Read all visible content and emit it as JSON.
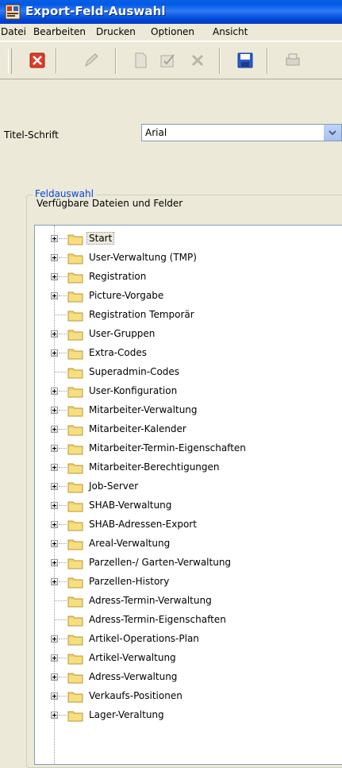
{
  "window": {
    "title": "Export-Feld-Auswahl",
    "app_icon": "app-icon"
  },
  "menu": [
    "Datei",
    "Bearbeiten",
    "Drucken",
    "Optionen",
    "Ansicht"
  ],
  "toolbar": {
    "buttons": [
      "close-red-x-icon",
      "edit-pencil-icon",
      "new-document-icon",
      "check-document-icon",
      "delete-x-icon",
      "save-disk-icon",
      "print-icon"
    ]
  },
  "title_font": {
    "label": "Titel-Schrift",
    "value": "Arial"
  },
  "field_selection": {
    "group_title": "Feldauswahl",
    "list_label": "Verfügbare Dateien und Felder",
    "items": [
      {
        "label": "Start",
        "expandable": true,
        "selected": true
      },
      {
        "label": "User-Verwaltung (TMP)",
        "expandable": true
      },
      {
        "label": "Registration",
        "expandable": true
      },
      {
        "label": "Picture-Vorgabe",
        "expandable": true
      },
      {
        "label": "Registration Temporär",
        "expandable": false
      },
      {
        "label": "User-Gruppen",
        "expandable": true
      },
      {
        "label": "Extra-Codes",
        "expandable": true
      },
      {
        "label": "Superadmin-Codes",
        "expandable": false
      },
      {
        "label": "User-Konfiguration",
        "expandable": true
      },
      {
        "label": "Mitarbeiter-Verwaltung",
        "expandable": true
      },
      {
        "label": "Mitarbeiter-Kalender",
        "expandable": true
      },
      {
        "label": "Mitarbeiter-Termin-Eigenschaften",
        "expandable": true
      },
      {
        "label": "Mitarbeiter-Berechtigungen",
        "expandable": true
      },
      {
        "label": "Job-Server",
        "expandable": true
      },
      {
        "label": "SHAB-Verwaltung",
        "expandable": true
      },
      {
        "label": "SHAB-Adressen-Export",
        "expandable": true
      },
      {
        "label": "Areal-Verwaltung",
        "expandable": true
      },
      {
        "label": "Parzellen-/ Garten-Verwaltung",
        "expandable": true
      },
      {
        "label": "Parzellen-History",
        "expandable": true
      },
      {
        "label": "Adress-Termin-Verwaltung",
        "expandable": false
      },
      {
        "label": "Adress-Termin-Eigenschaften",
        "expandable": false
      },
      {
        "label": "Artikel-Operations-Plan",
        "expandable": true
      },
      {
        "label": "Artikel-Verwaltung",
        "expandable": true
      },
      {
        "label": "Adress-Verwaltung",
        "expandable": true
      },
      {
        "label": "Verkaufs-Positionen",
        "expandable": true
      },
      {
        "label": "Lager-Veraltung",
        "expandable": true
      }
    ]
  }
}
